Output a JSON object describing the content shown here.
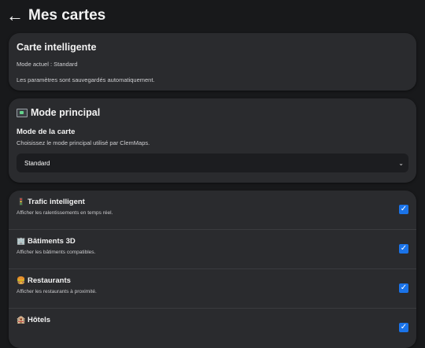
{
  "header": {
    "back_icon": "←",
    "title": "Mes cartes"
  },
  "smart_card": {
    "title": "Carte intelligente",
    "mode_line": "Mode actuel : Standard",
    "autosave_line": "Les paramètres sont sauvegardés automatiquement."
  },
  "main_mode": {
    "title": "Mode principal",
    "icon": "world-map-icon",
    "section_title": "Mode de la carte",
    "description": "Choisissez le mode principal utilisé par ClemMaps.",
    "select_value": "Standard",
    "select_icon": "chevron-down-icon"
  },
  "options": [
    {
      "emoji": "🚦",
      "title": "Trafic intelligent",
      "desc": "Afficher les ralentissements en temps réel.",
      "checked": true
    },
    {
      "emoji": "🏢",
      "title": "Bâtiments 3D",
      "desc": "Afficher les bâtiments compatibles.",
      "checked": true
    },
    {
      "emoji": "🍔",
      "title": "Restaurants",
      "desc": "Afficher les restaurants à proximité.",
      "checked": true
    },
    {
      "emoji": "🏨",
      "title": "Hôtels",
      "desc": "",
      "checked": true
    }
  ],
  "checkmark": "✓"
}
